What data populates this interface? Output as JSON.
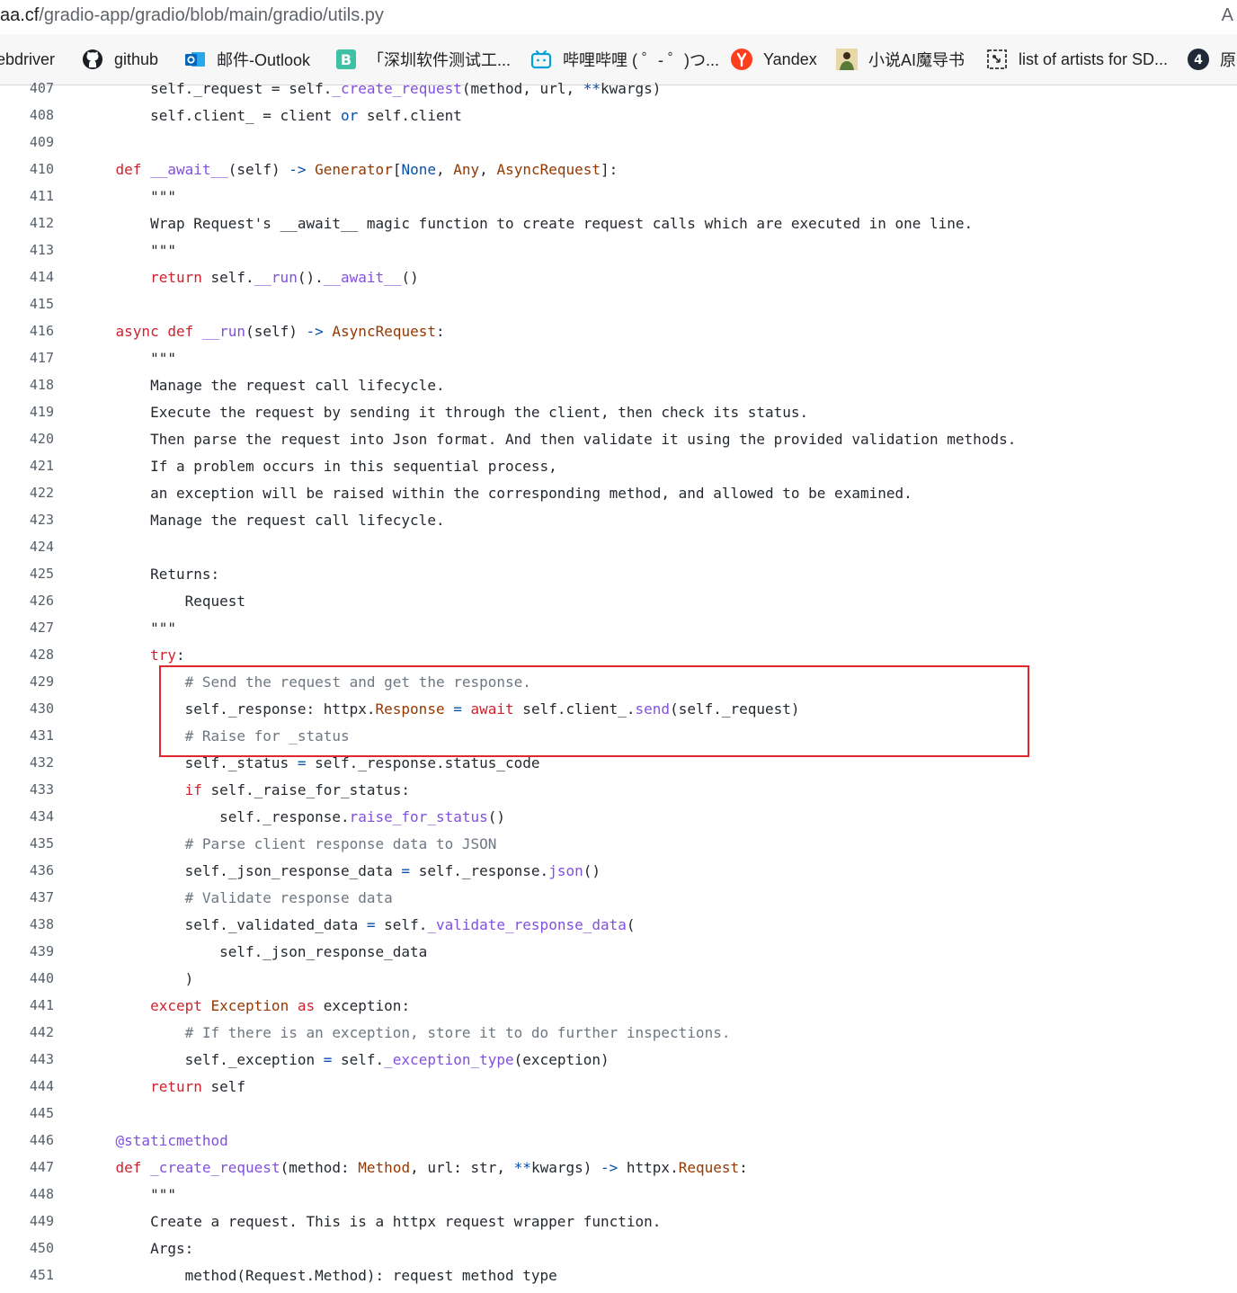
{
  "browser": {
    "url_host": "aa.cf",
    "url_path": "/gradio-app/gradio/blob/main/gradio/utils.py",
    "edge_char": "A"
  },
  "bookmarks": [
    {
      "label": "ebdriver",
      "icon": "none"
    },
    {
      "label": "github",
      "icon": "github-icon"
    },
    {
      "label": "邮件-Outlook",
      "icon": "outlook-icon"
    },
    {
      "label": "「深圳软件测试工...",
      "icon": "b-icon"
    },
    {
      "label": "哔哩哔哩 ( ゜- ゜)つ...",
      "icon": "bilibili-icon"
    },
    {
      "label": "Yandex",
      "icon": "yandex-icon"
    },
    {
      "label": "小说AI魔导书",
      "icon": "avatar-icon"
    },
    {
      "label": "list of artists for SD...",
      "icon": "page-icon"
    },
    {
      "label": "原",
      "icon": "circle-4-icon"
    }
  ],
  "code": [
    {
      "n": "407",
      "t": [
        [
          "        self._request = self.",
          ""
        ],
        [
          "_create_request",
          "fn"
        ],
        [
          "(method, url, ",
          ""
        ],
        [
          "**",
          "bl"
        ],
        [
          "kwargs)",
          ""
        ]
      ]
    },
    {
      "n": "408",
      "t": [
        [
          "        self.client_ = client ",
          ""
        ],
        [
          "or",
          "bl"
        ],
        [
          " self.client",
          ""
        ]
      ]
    },
    {
      "n": "409",
      "t": []
    },
    {
      "n": "410",
      "t": [
        [
          "    ",
          ""
        ],
        [
          "def",
          "kw"
        ],
        [
          " ",
          ""
        ],
        [
          "__await__",
          "fn"
        ],
        [
          "(self) ",
          ""
        ],
        [
          "->",
          "bl"
        ],
        [
          " ",
          ""
        ],
        [
          "Generator",
          "ty"
        ],
        [
          "[",
          ""
        ],
        [
          "None",
          "bl"
        ],
        [
          ", ",
          ""
        ],
        [
          "Any",
          "ty"
        ],
        [
          ", ",
          ""
        ],
        [
          "AsyncRequest",
          "ty"
        ],
        [
          "]:",
          ""
        ]
      ]
    },
    {
      "n": "411",
      "t": [
        [
          "        \"\"\"",
          ""
        ]
      ]
    },
    {
      "n": "412",
      "t": [
        [
          "        Wrap Request's __await__ magic function to create request calls which are executed in one line.",
          ""
        ]
      ]
    },
    {
      "n": "413",
      "t": [
        [
          "        \"\"\"",
          ""
        ]
      ]
    },
    {
      "n": "414",
      "t": [
        [
          "        ",
          ""
        ],
        [
          "return",
          "kw"
        ],
        [
          " self.",
          ""
        ],
        [
          "__run",
          "fn"
        ],
        [
          "().",
          ""
        ],
        [
          "__await__",
          "fn"
        ],
        [
          "()",
          ""
        ]
      ]
    },
    {
      "n": "415",
      "t": []
    },
    {
      "n": "416",
      "t": [
        [
          "    ",
          ""
        ],
        [
          "async",
          "kw"
        ],
        [
          " ",
          ""
        ],
        [
          "def",
          "kw"
        ],
        [
          " ",
          ""
        ],
        [
          "__run",
          "fn"
        ],
        [
          "(self) ",
          ""
        ],
        [
          "->",
          "bl"
        ],
        [
          " ",
          ""
        ],
        [
          "AsyncRequest",
          "ty"
        ],
        [
          ":",
          ""
        ]
      ]
    },
    {
      "n": "417",
      "t": [
        [
          "        \"\"\"",
          ""
        ]
      ]
    },
    {
      "n": "418",
      "t": [
        [
          "        Manage the request call lifecycle.",
          ""
        ]
      ]
    },
    {
      "n": "419",
      "t": [
        [
          "        Execute the request by sending it through the client, then check its status.",
          ""
        ]
      ]
    },
    {
      "n": "420",
      "t": [
        [
          "        Then parse the request into Json format. And then validate it using the provided validation methods.",
          ""
        ]
      ]
    },
    {
      "n": "421",
      "t": [
        [
          "        If a problem occurs in this sequential process,",
          ""
        ]
      ]
    },
    {
      "n": "422",
      "t": [
        [
          "        an exception will be raised within the corresponding method, and allowed to be examined.",
          ""
        ]
      ]
    },
    {
      "n": "423",
      "t": [
        [
          "        Manage the request call lifecycle.",
          ""
        ]
      ]
    },
    {
      "n": "424",
      "t": []
    },
    {
      "n": "425",
      "t": [
        [
          "        Returns:",
          ""
        ]
      ]
    },
    {
      "n": "426",
      "t": [
        [
          "            Request",
          ""
        ]
      ]
    },
    {
      "n": "427",
      "t": [
        [
          "        \"\"\"",
          ""
        ]
      ]
    },
    {
      "n": "428",
      "t": [
        [
          "        ",
          ""
        ],
        [
          "try",
          "kw"
        ],
        [
          ":",
          ""
        ]
      ]
    },
    {
      "n": "429",
      "t": [
        [
          "            ",
          ""
        ],
        [
          "# Send the request and get the response.",
          "c"
        ]
      ]
    },
    {
      "n": "430",
      "t": [
        [
          "            self._response: httpx.",
          ""
        ],
        [
          "Response",
          "ty"
        ],
        [
          " ",
          ""
        ],
        [
          "=",
          "bl"
        ],
        [
          " ",
          ""
        ],
        [
          "await",
          "kw"
        ],
        [
          " self.client_.",
          ""
        ],
        [
          "send",
          "fn"
        ],
        [
          "(self._request)",
          ""
        ]
      ]
    },
    {
      "n": "431",
      "t": [
        [
          "            ",
          ""
        ],
        [
          "# Raise for _status",
          "c"
        ]
      ]
    },
    {
      "n": "432",
      "t": [
        [
          "            self._status ",
          ""
        ],
        [
          "=",
          "bl"
        ],
        [
          " self._response.status_code",
          ""
        ]
      ]
    },
    {
      "n": "433",
      "t": [
        [
          "            ",
          ""
        ],
        [
          "if",
          "kw"
        ],
        [
          " self._raise_for_status:",
          ""
        ]
      ]
    },
    {
      "n": "434",
      "t": [
        [
          "                self._response.",
          ""
        ],
        [
          "raise_for_status",
          "fn"
        ],
        [
          "()",
          ""
        ]
      ]
    },
    {
      "n": "435",
      "t": [
        [
          "            ",
          ""
        ],
        [
          "# Parse client response data to JSON",
          "c"
        ]
      ]
    },
    {
      "n": "436",
      "t": [
        [
          "            self._json_response_data ",
          ""
        ],
        [
          "=",
          "bl"
        ],
        [
          " self._response.",
          ""
        ],
        [
          "json",
          "fn"
        ],
        [
          "()",
          ""
        ]
      ]
    },
    {
      "n": "437",
      "t": [
        [
          "            ",
          ""
        ],
        [
          "# Validate response data",
          "c"
        ]
      ]
    },
    {
      "n": "438",
      "t": [
        [
          "            self._validated_data ",
          ""
        ],
        [
          "=",
          "bl"
        ],
        [
          " self.",
          ""
        ],
        [
          "_validate_response_data",
          "fn"
        ],
        [
          "(",
          ""
        ]
      ]
    },
    {
      "n": "439",
      "t": [
        [
          "                self._json_response_data",
          ""
        ]
      ]
    },
    {
      "n": "440",
      "t": [
        [
          "            )",
          ""
        ]
      ]
    },
    {
      "n": "441",
      "t": [
        [
          "        ",
          ""
        ],
        [
          "except",
          "kw"
        ],
        [
          " ",
          ""
        ],
        [
          "Exception",
          "ty"
        ],
        [
          " ",
          ""
        ],
        [
          "as",
          "kw"
        ],
        [
          " exception:",
          ""
        ]
      ]
    },
    {
      "n": "442",
      "t": [
        [
          "            ",
          ""
        ],
        [
          "# If there is an exception, store it to do further inspections.",
          "c"
        ]
      ]
    },
    {
      "n": "443",
      "t": [
        [
          "            self._exception ",
          ""
        ],
        [
          "=",
          "bl"
        ],
        [
          " self.",
          ""
        ],
        [
          "_exception_type",
          "fn"
        ],
        [
          "(exception)",
          ""
        ]
      ]
    },
    {
      "n": "444",
      "t": [
        [
          "        ",
          ""
        ],
        [
          "return",
          "kw"
        ],
        [
          " self",
          ""
        ]
      ]
    },
    {
      "n": "445",
      "t": []
    },
    {
      "n": "446",
      "t": [
        [
          "    ",
          ""
        ],
        [
          "@staticmethod",
          "fn"
        ]
      ]
    },
    {
      "n": "447",
      "t": [
        [
          "    ",
          ""
        ],
        [
          "def",
          "kw"
        ],
        [
          " ",
          ""
        ],
        [
          "_create_request",
          "fn"
        ],
        [
          "(method: ",
          ""
        ],
        [
          "Method",
          "ty"
        ],
        [
          ", url: str, ",
          ""
        ],
        [
          "**",
          "bl"
        ],
        [
          "kwargs) ",
          ""
        ],
        [
          "->",
          "bl"
        ],
        [
          " httpx.",
          ""
        ],
        [
          "Request",
          "ty"
        ],
        [
          ":",
          ""
        ]
      ]
    },
    {
      "n": "448",
      "t": [
        [
          "        \"\"\"",
          ""
        ]
      ]
    },
    {
      "n": "449",
      "t": [
        [
          "        Create a request. This is a httpx request wrapper function.",
          ""
        ]
      ]
    },
    {
      "n": "450",
      "t": [
        [
          "        Args:",
          ""
        ]
      ]
    },
    {
      "n": "451",
      "t": [
        [
          "            method(Request.Method): request method type",
          ""
        ]
      ]
    }
  ]
}
